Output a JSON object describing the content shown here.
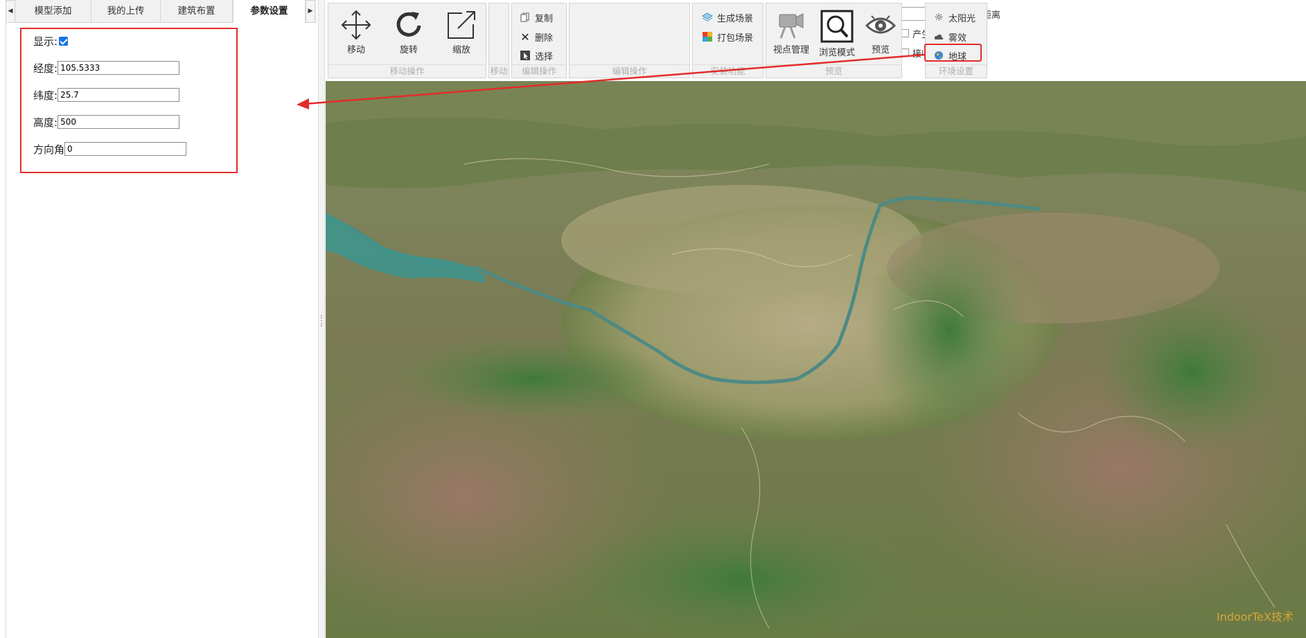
{
  "tabs": [
    {
      "label": "模型添加"
    },
    {
      "label": "我的上传"
    },
    {
      "label": "建筑布置"
    },
    {
      "label": "参数设置"
    }
  ],
  "params": {
    "show_label": "显示:",
    "show_checked": true,
    "lon_label": "经度:",
    "lon_value": "105.5333",
    "lat_label": "纬度:",
    "lat_value": "25.7",
    "alt_label": "高度:",
    "alt_value": "500",
    "heading_label": "方向角",
    "heading_value": "0"
  },
  "ribbon": {
    "move_group": {
      "label": "移动操作",
      "buttons": [
        "移动",
        "旋转",
        "缩放"
      ]
    },
    "move_small_group": {
      "label": "移动"
    },
    "edit_group": {
      "label": "编辑操作",
      "copy": "复制",
      "delete": "删除",
      "select": "选择"
    },
    "lod_group": {
      "lod_label": "LOD距离",
      "cast_shadow": "产生阴影",
      "receive_shadow": "接收阴影"
    },
    "install_group": {
      "label": "安装功能",
      "gen_scene": "生成场景",
      "pack_scene": "打包场景"
    },
    "preview_group": {
      "label": "预览",
      "viewpoint": "视点管理",
      "browse_mode": "浏览模式",
      "preview": "预览"
    },
    "env_group": {
      "label": "环境设置",
      "sunlight": "太阳光",
      "fog": "雾效",
      "earth": "地球"
    }
  },
  "map": {
    "watermark": "IndoorTeX技术"
  }
}
